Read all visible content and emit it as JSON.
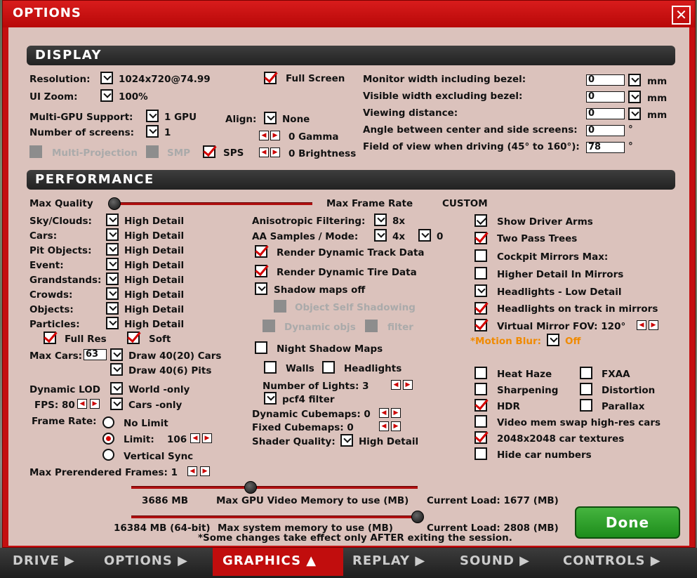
{
  "window": {
    "title": "OPTIONS"
  },
  "display": {
    "header": "DISPLAY",
    "resolution_label": "Resolution:",
    "resolution_value": "1024x720@74.99",
    "ui_zoom_label": "UI Zoom:",
    "ui_zoom_value": "100%",
    "multigpu_label": "Multi-GPU Support:",
    "multigpu_value": "1 GPU",
    "screens_label": "Number of screens:",
    "screens_value": "1",
    "multiprojection_label": "Multi-Projection",
    "smp_label": "SMP",
    "sps_label": "SPS",
    "fullscreen_label": "Full Screen",
    "align_label": "Align:",
    "align_value": "None",
    "gamma_label": "0 Gamma",
    "brightness_label": "0 Brightness",
    "monitor_width_label": "Monitor width including bezel:",
    "monitor_width_value": "0",
    "visible_width_label": "Visible width excluding bezel:",
    "visible_width_value": "0",
    "viewing_distance_label": "Viewing distance:",
    "viewing_distance_value": "0",
    "angle_label": "Angle between center and side screens:",
    "angle_value": "0",
    "fov_label": "Field of view when driving (45° to 160°):",
    "fov_value": "78",
    "mm": "mm",
    "deg": "°"
  },
  "performance": {
    "header": "PERFORMANCE",
    "max_quality": "Max Quality",
    "max_frame_rate": "Max Frame Rate",
    "custom": "CUSTOM",
    "detail_rows": [
      {
        "label": "Sky/Clouds:",
        "value": "High Detail"
      },
      {
        "label": "Cars:",
        "value": "High Detail"
      },
      {
        "label": "Pit Objects:",
        "value": "High Detail"
      },
      {
        "label": "Event:",
        "value": "High Detail"
      },
      {
        "label": "Grandstands:",
        "value": "High Detail"
      },
      {
        "label": "Crowds:",
        "value": "High Detail"
      },
      {
        "label": "Objects:",
        "value": "High Detail"
      },
      {
        "label": "Particles:",
        "value": "High Detail"
      }
    ],
    "full_res": "Full Res",
    "soft": "Soft",
    "max_cars_label": "Max Cars:",
    "max_cars_value": "63",
    "draw_cars": "Draw 40(20) Cars",
    "draw_pits": "Draw 40(6) Pits",
    "dynamic_lod": "Dynamic LOD",
    "world_only": "World -only",
    "fps_label": "FPS: 80",
    "cars_only": "Cars -only",
    "frame_rate_label": "Frame Rate:",
    "no_limit": "No Limit",
    "limit": "Limit:",
    "limit_value": "106",
    "vsync": "Vertical Sync",
    "prerendered": "Max Prerendered Frames: 1",
    "aniso_label": "Anisotropic Filtering:",
    "aniso_value": "8x",
    "aa_label": "AA Samples / Mode:",
    "aa_value": "4x",
    "aa_mode": "0",
    "dyn_track": "Render Dynamic Track Data",
    "dyn_tire": "Render Dynamic Tire Data",
    "shadow_maps": "Shadow maps off",
    "obj_self_shadow": "Object Self Shadowing",
    "dynamic_objs": "Dynamic objs",
    "filter": "filter",
    "night_shadow": "Night Shadow Maps",
    "walls": "Walls",
    "headlights": "Headlights",
    "num_lights": "Number of Lights: 3",
    "pcf4": "pcf4 filter",
    "dyn_cubemaps": "Dynamic Cubemaps: 0",
    "fixed_cubemaps": "Fixed Cubemaps: 0",
    "shader_quality_label": "Shader Quality:",
    "shader_quality_value": "High Detail",
    "show_arms": "Show Driver Arms",
    "two_pass": "Two Pass Trees",
    "cockpit_mirrors": "Cockpit Mirrors  Max:",
    "higher_detail_mirrors": "Higher Detail In Mirrors",
    "headlights_low": "Headlights - Low Detail",
    "headlights_track": "Headlights on track in mirrors",
    "virtual_mirror": "Virtual Mirror  FOV:  120°",
    "motion_blur_label": "*Motion Blur:",
    "motion_blur_value": "Off",
    "heat_haze": "Heat Haze",
    "fxaa": "FXAA",
    "sharpening": "Sharpening",
    "distortion": "Distortion",
    "hdr": "HDR",
    "parallax": "Parallax",
    "video_swap": "Video mem swap high-res cars",
    "textures_2048": "2048x2048 car textures",
    "hide_numbers": "Hide car numbers",
    "gpu_mem_value": "3686 MB",
    "gpu_mem_label": "Max GPU Video Memory to use (MB)",
    "gpu_load": "Current Load: 1677 (MB)",
    "sys_mem_value": "16384 MB (64-bit)",
    "sys_mem_label": "Max system memory to use (MB)",
    "sys_load": "Current Load: 2808 (MB)",
    "note": "*Some changes take effect only AFTER exiting the session.",
    "done": "Done"
  },
  "tabs": [
    {
      "label": "DRIVE ▶"
    },
    {
      "label": "OPTIONS ▶"
    },
    {
      "label": "GRAPHICS ▲"
    },
    {
      "label": "REPLAY ▶"
    },
    {
      "label": "SOUND ▶"
    },
    {
      "label": "CONTROLS ▶"
    }
  ],
  "colors": {
    "accent": "#c40f10",
    "check": "#d40000",
    "done": "#2ea12a"
  }
}
